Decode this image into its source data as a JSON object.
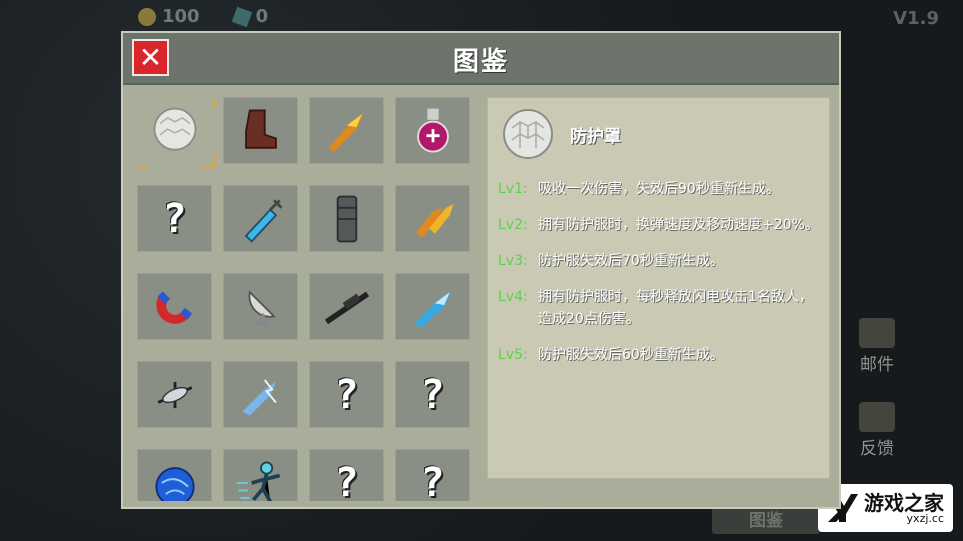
{
  "hud": {
    "coins": "100",
    "gems": "0",
    "version": "V1.9"
  },
  "side": {
    "mail_label": "邮件",
    "feedback_label": "反馈",
    "bottom_tab": "图鉴"
  },
  "logo": {
    "cn": "游戏之家",
    "url": "yxzj.cc"
  },
  "panel": {
    "title": "图鉴",
    "close_symbol": "✕"
  },
  "grid": [
    [
      {
        "icon": "shield-bubble",
        "selected": true
      },
      {
        "icon": "boots"
      },
      {
        "icon": "flame-bullet"
      },
      {
        "icon": "potion"
      }
    ],
    [
      {
        "icon": "unknown",
        "q": "?"
      },
      {
        "icon": "syringe"
      },
      {
        "icon": "magazine"
      },
      {
        "icon": "fire-bullets"
      }
    ],
    [
      {
        "icon": "magnet"
      },
      {
        "icon": "radar-dish"
      },
      {
        "icon": "scope-rifle"
      },
      {
        "icon": "ice-bullet"
      }
    ],
    [
      {
        "icon": "spinning-shuriken"
      },
      {
        "icon": "lightning-bullet"
      },
      {
        "icon": "unknown",
        "q": "?"
      },
      {
        "icon": "unknown",
        "q": "?"
      }
    ],
    [
      {
        "icon": "plasma-orb"
      },
      {
        "icon": "speed-runner"
      },
      {
        "icon": "unknown",
        "q": "?"
      },
      {
        "icon": "unknown",
        "q": "?"
      }
    ]
  ],
  "detail": {
    "name": "防护罩",
    "levels": [
      {
        "k": "Lv1:",
        "v": "吸收一次伤害，失效后90秒重新生成。"
      },
      {
        "k": "Lv2:",
        "v": "拥有防护服时，换弹速度及移动速度+20%。"
      },
      {
        "k": "Lv3:",
        "v": "防护服失效后70秒重新生成。"
      },
      {
        "k": "Lv4:",
        "v": "拥有防护服时，每秒释放闪电攻击1名敌人，造成20点伤害。"
      },
      {
        "k": "Lv5:",
        "v": "防护服失效后60秒重新生成。"
      }
    ]
  }
}
